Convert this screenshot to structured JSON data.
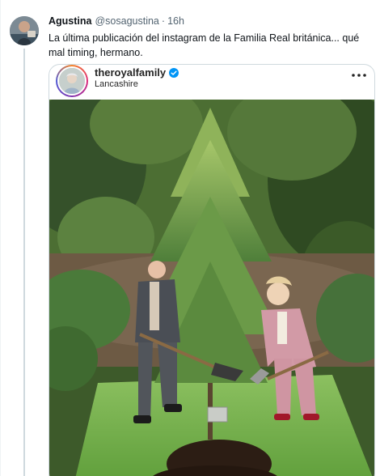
{
  "tweet": {
    "author_name": "Agustina",
    "author_handle": "@sosagustina",
    "separator": "·",
    "timestamp": "16h",
    "text": "La última publicación del instagram de la Familia Real británica... qué mal timing, hermano."
  },
  "embed": {
    "account": "theroyalfamily",
    "location": "Lancashire",
    "verified_icon": "verified-badge-icon",
    "more_icon": "more-dots-icon",
    "verified_color": "#0095f6"
  },
  "colors": {
    "text_primary": "#0f1419",
    "text_secondary": "#536471",
    "border": "#cfd9de"
  }
}
